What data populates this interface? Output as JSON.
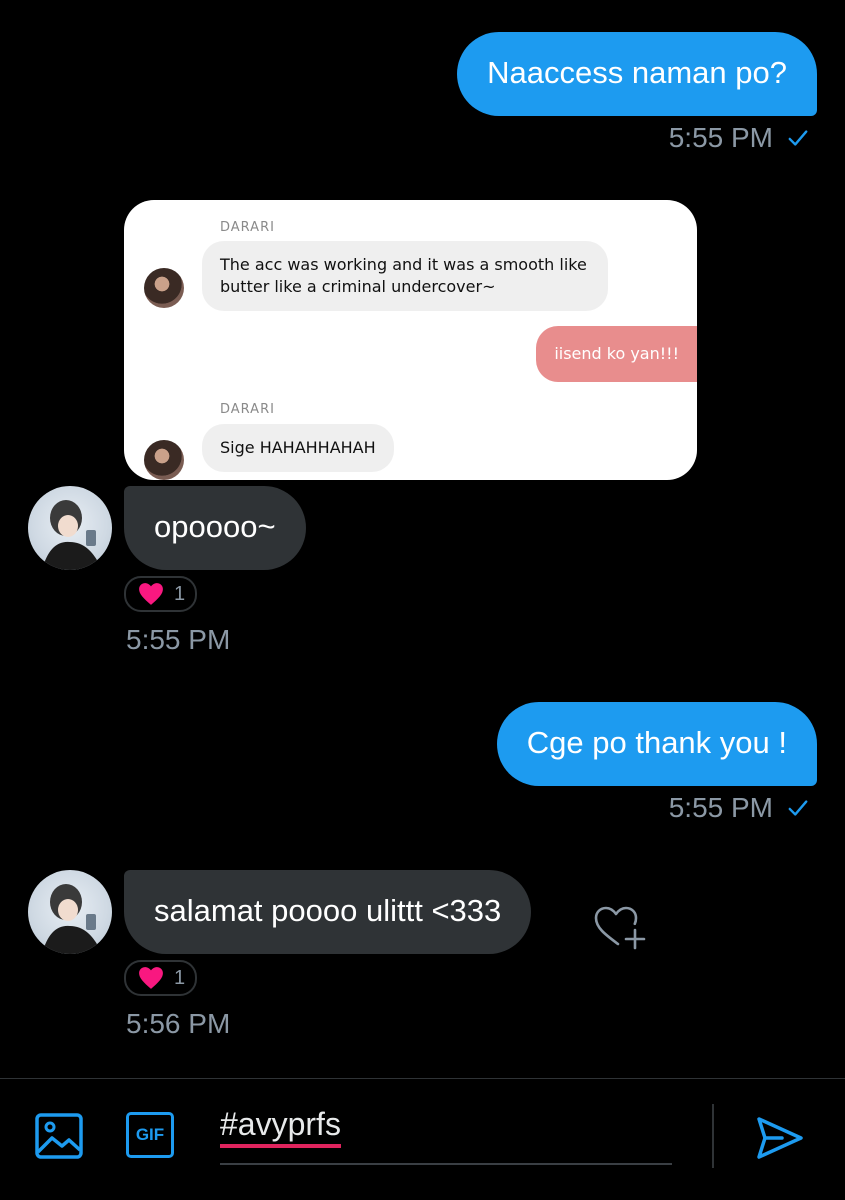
{
  "messages": [
    {
      "id": "m1",
      "side": "outgoing",
      "text": "Naaccess naman po?",
      "time": "5:55 PM"
    },
    {
      "id": "m2",
      "side": "incoming",
      "text": "opoooo~",
      "reaction_count": "1",
      "time": "5:55 PM"
    },
    {
      "id": "m3",
      "side": "outgoing",
      "text": "Cge po thank you !",
      "time": "5:55 PM"
    },
    {
      "id": "m4",
      "side": "incoming",
      "text": "salamat poooo ulittt <333",
      "reaction_count": "1",
      "time": "5:56 PM"
    }
  ],
  "embedded_screenshot": {
    "sender_name_1": "DARARI",
    "message_1": "The acc was working and it was a smooth like butter like a criminal undercover~",
    "reply": "iisend ko yan!!!",
    "sender_name_2": "DARARI",
    "message_2": "Sige HAHAHHAHAH"
  },
  "composer": {
    "text": "#avyprfs",
    "gif_label": "GIF"
  },
  "colors": {
    "accent": "#1d9bf0",
    "incoming_bubble": "#2f3336",
    "timestamp": "#8b98a5",
    "heart": "#f91880",
    "spellcheck_underline": "#e0245e"
  },
  "icons": [
    "check-icon",
    "heart-icon",
    "add-reaction-icon",
    "image-icon",
    "gif-icon",
    "send-icon"
  ]
}
